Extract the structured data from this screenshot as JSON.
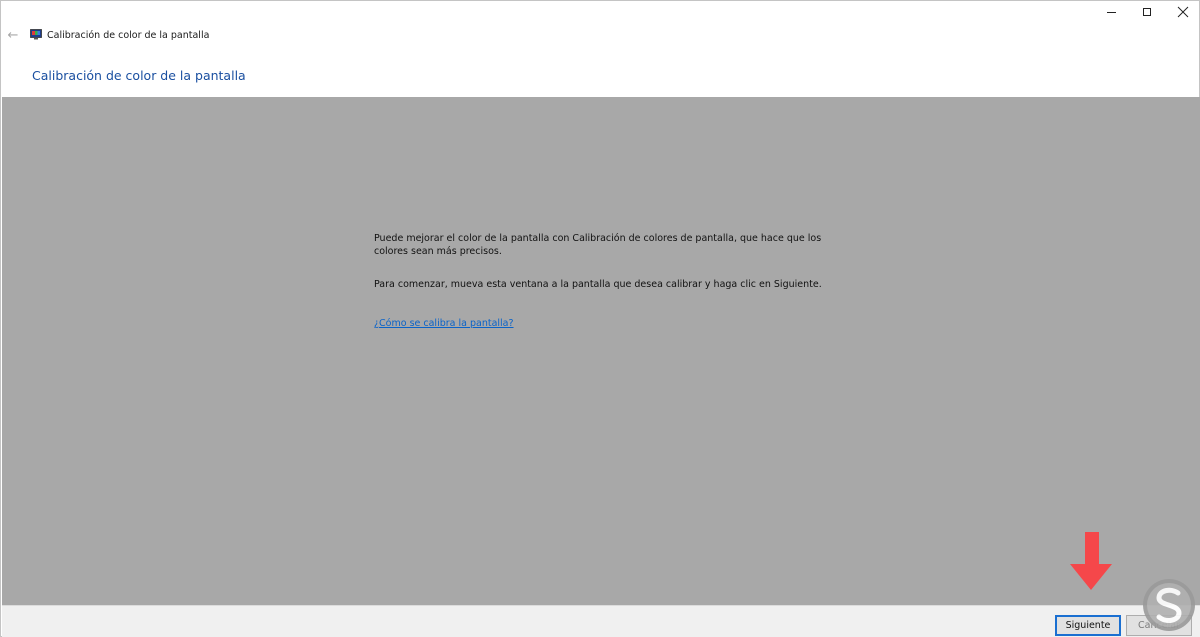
{
  "window": {
    "title": "Calibración de color de la pantalla",
    "app_icon": "display-calibration-icon",
    "controls": [
      "minimize-icon",
      "maximize-icon",
      "close-icon"
    ]
  },
  "header": {
    "title": "Calibración de color de la pantalla"
  },
  "main": {
    "paragraph1": "Puede mejorar el color de la pantalla con Calibración de colores de pantalla, que hace que los colores sean más precisos.",
    "paragraph2": "Para comenzar, mueva esta ventana a la pantalla que desea calibrar y haga clic en Siguiente.",
    "help_link": "¿Cómo se calibra la pantalla?"
  },
  "footer": {
    "next_label": "Siguiente",
    "cancel_label": "Cancelar"
  },
  "colors": {
    "accent": "#1a4fa0",
    "link": "#0a63c9",
    "content_bg": "#a8a8a8",
    "annotation_arrow": "#f5474a"
  }
}
